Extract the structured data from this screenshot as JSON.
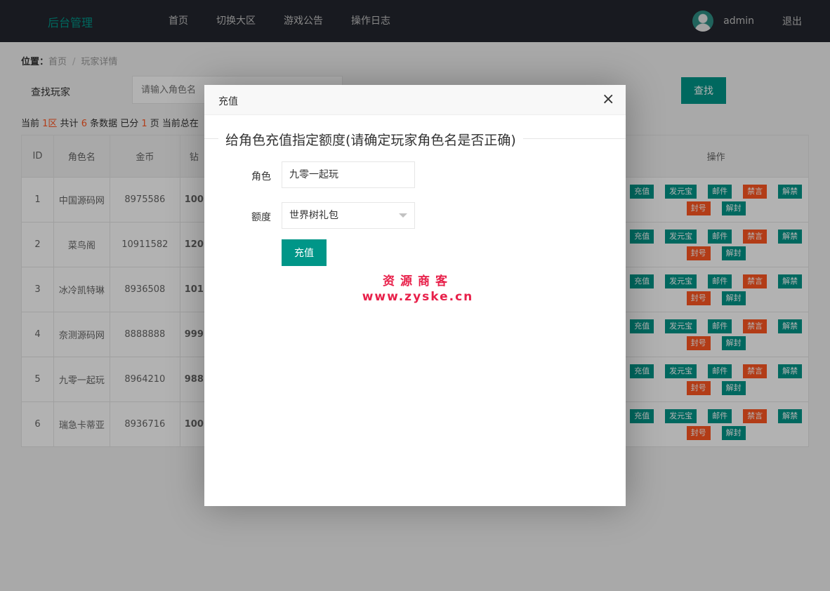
{
  "header": {
    "logo": "后台管理",
    "nav": [
      "首页",
      "切换大区",
      "游戏公告",
      "操作日志"
    ],
    "username": "admin",
    "logout": "退出"
  },
  "breadcrumb": {
    "label": "位置：",
    "home": "首页",
    "sep": "/",
    "current": "玩家详情"
  },
  "search": {
    "label": "查找玩家",
    "placeholder": "请输入角色名",
    "button": "查找"
  },
  "stats": {
    "p1": "当前 ",
    "zone": "1区",
    "p2": " 共计 ",
    "count": "6",
    "p3": " 条数据 已分 ",
    "pages": "1",
    "p4": " 页 当前总在"
  },
  "table": {
    "headers": [
      "ID",
      "角色名",
      "金币",
      "钻",
      "操作"
    ],
    "rows": [
      {
        "id": "1",
        "name": "中国源码网",
        "gold": "8975586",
        "col4": "100"
      },
      {
        "id": "2",
        "name": "菜鸟阁",
        "gold": "10911582",
        "col4": "120"
      },
      {
        "id": "3",
        "name": "冰冷凯特琳",
        "gold": "8936508",
        "col4": "101"
      },
      {
        "id": "4",
        "name": "奈测源码网",
        "gold": "8888888",
        "col4": "999"
      },
      {
        "id": "5",
        "name": "九零一起玩",
        "gold": "8964210",
        "col4": "988"
      },
      {
        "id": "6",
        "name": "瑞急卡蒂亚",
        "gold": "8936716",
        "col4": "100"
      }
    ],
    "ops": {
      "recharge": "充值",
      "yuanbao": "发元宝",
      "mail": "邮件",
      "mute": "禁言",
      "unmute": "解禁",
      "ban": "封号",
      "unban": "解封"
    }
  },
  "modal": {
    "title": "充值",
    "close": "×",
    "legend": "给角色充值指定额度(请确定玩家角色名是否正确)",
    "role_label": "角色",
    "role_value": "九零一起玩",
    "amount_label": "额度",
    "amount_value": "世界树礼包",
    "submit": "充值"
  },
  "watermark": {
    "line1": "资源商客",
    "line2": "www.zyske.cn"
  }
}
